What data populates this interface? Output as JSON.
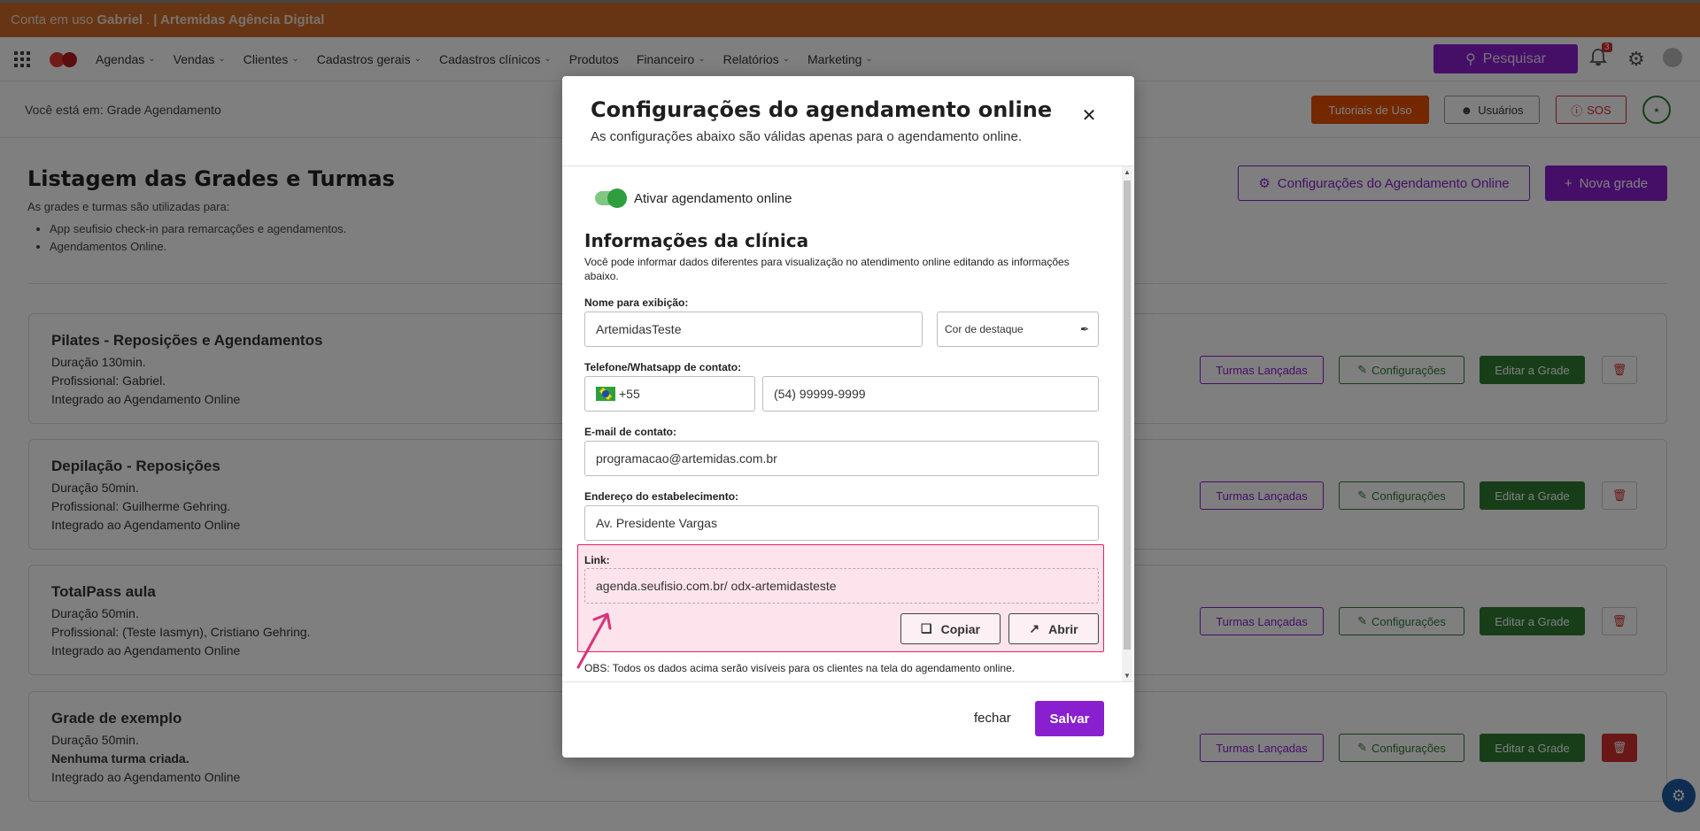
{
  "banner": {
    "prefix": "Conta em uso",
    "user": "Gabriel",
    "sep": ".",
    "account": "| Artemidas Agência Digital"
  },
  "nav": {
    "menu": [
      {
        "label": "Agendas",
        "dropdown": true
      },
      {
        "label": "Vendas",
        "dropdown": true
      },
      {
        "label": "Clientes",
        "dropdown": true
      },
      {
        "label": "Cadastros gerais",
        "dropdown": true
      },
      {
        "label": "Cadastros clínicos",
        "dropdown": true
      },
      {
        "label": "Produtos",
        "dropdown": false
      },
      {
        "label": "Financeiro",
        "dropdown": true
      },
      {
        "label": "Relatórios",
        "dropdown": true
      },
      {
        "label": "Marketing",
        "dropdown": true
      }
    ],
    "search_label": "Pesquisar",
    "notification_count": "3"
  },
  "subheader": {
    "breadcrumb": "Você está em: Grade Agendamento",
    "tutoriais": "Tutoriais de Uso",
    "usuarios": "Usuários",
    "sos": "SOS"
  },
  "page": {
    "title": "Listagem das Grades e Turmas",
    "desc": "As grades e turmas são utilizadas para:",
    "bullets": [
      "App seufisio check-in para remarcações e agendamentos.",
      "Agendamentos Online."
    ],
    "config_online_btn": "Configurações do Agendamento Online",
    "new_grid_btn": "Nova grade"
  },
  "cards": [
    {
      "title": "Pilates - Reposições e Agendamentos",
      "lines": [
        "Duração 130min.",
        "Profissional: Gabriel.",
        "Integrado ao Agendamento Online"
      ]
    },
    {
      "title": "Depilação - Reposições",
      "lines": [
        "Duração 50min.",
        "Profissional: Guilherme Gehring.",
        "Integrado ao Agendamento Online"
      ]
    },
    {
      "title": "TotalPass aula",
      "lines": [
        "Duração 50min.",
        "Profissional: (Teste Iasmyn), Cristiano Gehring.",
        "Integrado ao Agendamento Online"
      ]
    },
    {
      "title": "Grade de exemplo",
      "lines": [
        "Duração 50min.",
        "Nenhuma turma criada.",
        "Integrado ao Agendamento Online"
      ]
    }
  ],
  "card_buttons": {
    "turmas": "Turmas Lançadas",
    "config": "Configurações",
    "edit": "Editar a Grade"
  },
  "modal": {
    "title": "Configurações do agendamento online",
    "subtitle": "As configurações abaixo são válidas apenas para o agendamento online.",
    "toggle_label": "Ativar agendamento online",
    "toggle_on": true,
    "section_title": "Informações da clínica",
    "section_desc": "Você pode informar dados diferentes para visualização no atendimento online editando as informações abaixo.",
    "name_label": "Nome para exibição:",
    "name_value": "ArtemidasTeste",
    "color_label": "Cor de destaque",
    "phone_label": "Telefone/Whatsapp de contato:",
    "phone_ddi": "+55",
    "phone_value": "(54) 99999-9999",
    "email_label": "E-mail de contato:",
    "email_value": "programacao@artemidas.com.br",
    "address_label": "Endereço do estabelecimento:",
    "address_value": "Av. Presidente Vargas",
    "link_label": "Link:",
    "link_value": "agenda.seufisio.com.br/ odx-artemidasteste",
    "copy_btn": "Copiar",
    "open_btn": "Abrir",
    "obs": "OBS: Todos os dados acima serão visíveis para os clientes na tela do agendamento online.",
    "close_btn": "fechar",
    "save_btn": "Salvar"
  },
  "colors": {
    "brand_purple": "#8a1fd0",
    "banner_orange": "#cf6a28",
    "success_green": "#2e7d32",
    "danger_red": "#d32f2f",
    "link_highlight": "#fde4ec"
  }
}
